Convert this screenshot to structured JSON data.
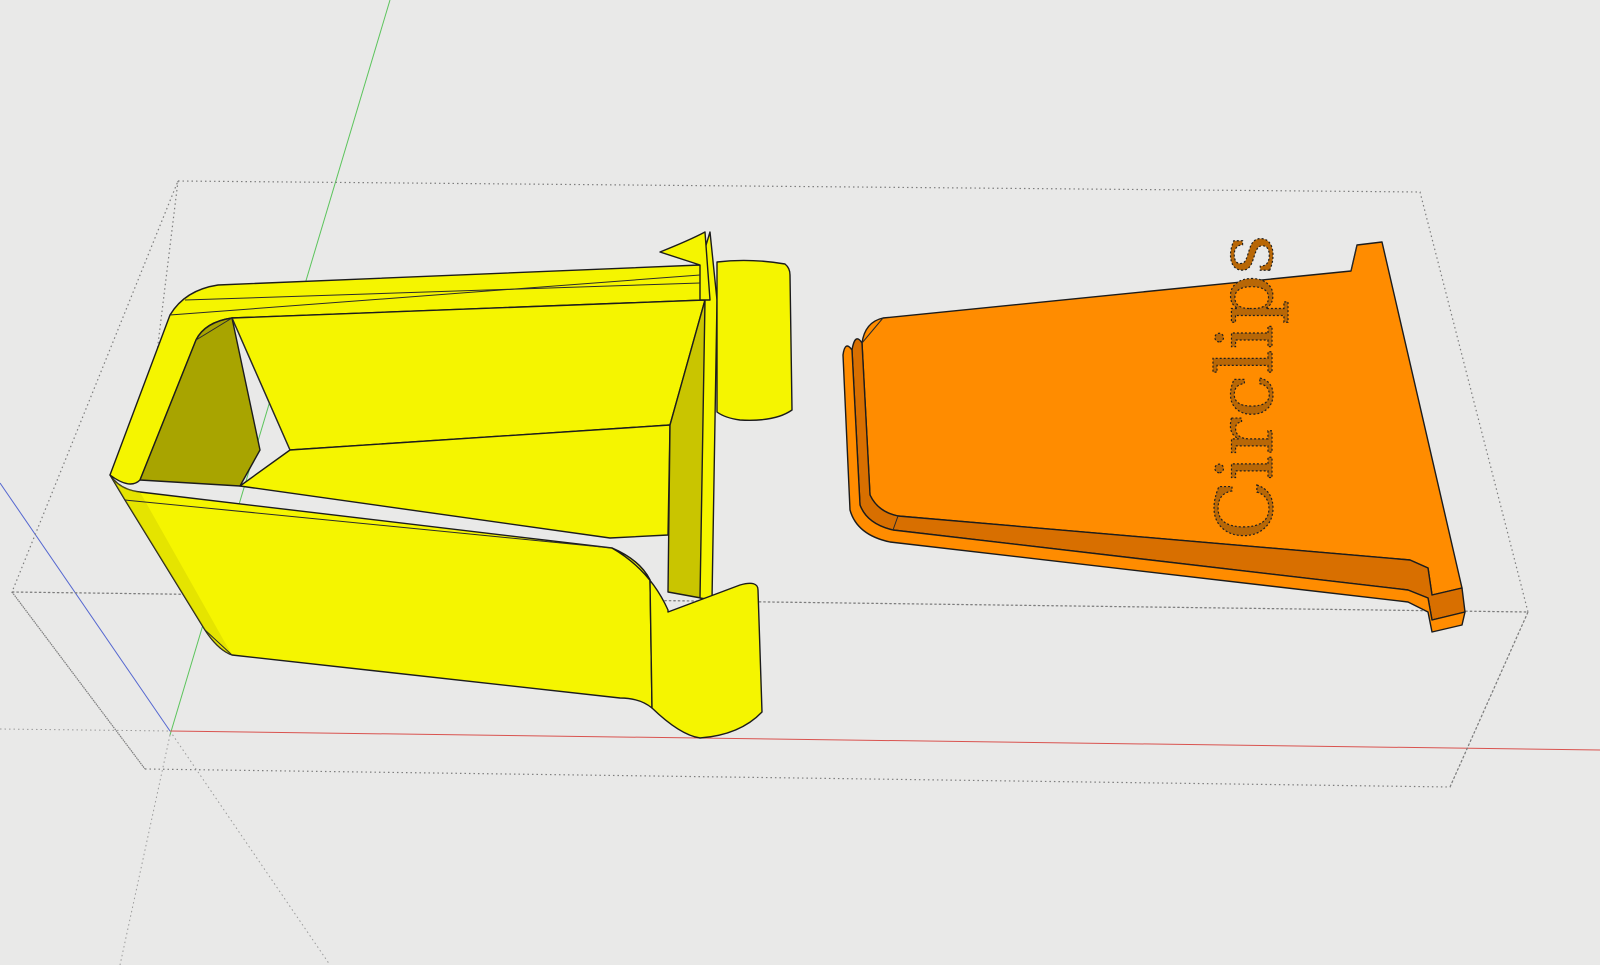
{
  "viewport": {
    "background_color": "#e9e9e8"
  },
  "axes": {
    "red_axis_color": "#d9534f",
    "green_axis_color": "#5cc45c",
    "blue_axis_color": "#5567d0"
  },
  "model": {
    "box": {
      "color": "#f5f500",
      "shade_color": "#c9c500",
      "dark_shade_color": "#a8a400"
    },
    "lid": {
      "color": "#ff8c00",
      "shade_color": "#d86f00",
      "engraved_text": "Circlips"
    }
  }
}
